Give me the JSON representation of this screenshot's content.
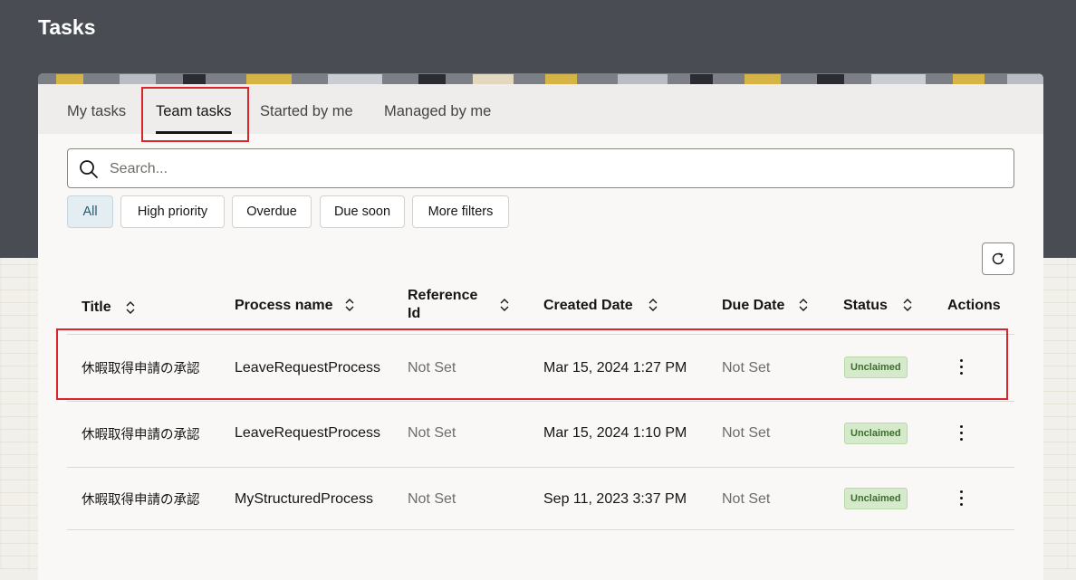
{
  "app": {
    "title": "Tasks"
  },
  "tabs": [
    {
      "label": "My tasks"
    },
    {
      "label": "Team tasks",
      "active": true
    },
    {
      "label": "Started by me"
    },
    {
      "label": "Managed by me"
    }
  ],
  "search": {
    "placeholder": "Search...",
    "value": "",
    "icon": "search-icon"
  },
  "filters": [
    {
      "label": "All",
      "selected": true
    },
    {
      "label": "High priority"
    },
    {
      "label": "Overdue"
    },
    {
      "label": "Due soon"
    },
    {
      "label": "More filters"
    }
  ],
  "refresh": {
    "icon": "refresh-icon"
  },
  "table": {
    "columns": [
      {
        "label": "Title"
      },
      {
        "label": "Process name"
      },
      {
        "label": "Reference Id"
      },
      {
        "label": "Created Date"
      },
      {
        "label": "Due Date"
      },
      {
        "label": "Status"
      },
      {
        "label": "Actions"
      }
    ],
    "rows": [
      {
        "title": "休暇取得申請の承認",
        "process": "LeaveRequestProcess",
        "reference": "Not Set",
        "created": "Mar 15, 2024 1:27 PM",
        "due": "Not Set",
        "status": "Unclaimed"
      },
      {
        "title": "休暇取得申請の承認",
        "process": "LeaveRequestProcess",
        "reference": "Not Set",
        "created": "Mar 15, 2024 1:10 PM",
        "due": "Not Set",
        "status": "Unclaimed"
      },
      {
        "title": "休暇取得申請の承認",
        "process": "MyStructuredProcess",
        "reference": "Not Set",
        "created": "Sep 11, 2023 3:37 PM",
        "due": "Not Set",
        "status": "Unclaimed"
      }
    ]
  },
  "colors": {
    "header_bg": "#4a4c53",
    "highlight_red": "#d9252b",
    "badge_bg": "#d4eacb",
    "badge_text": "#3d6c2d"
  }
}
